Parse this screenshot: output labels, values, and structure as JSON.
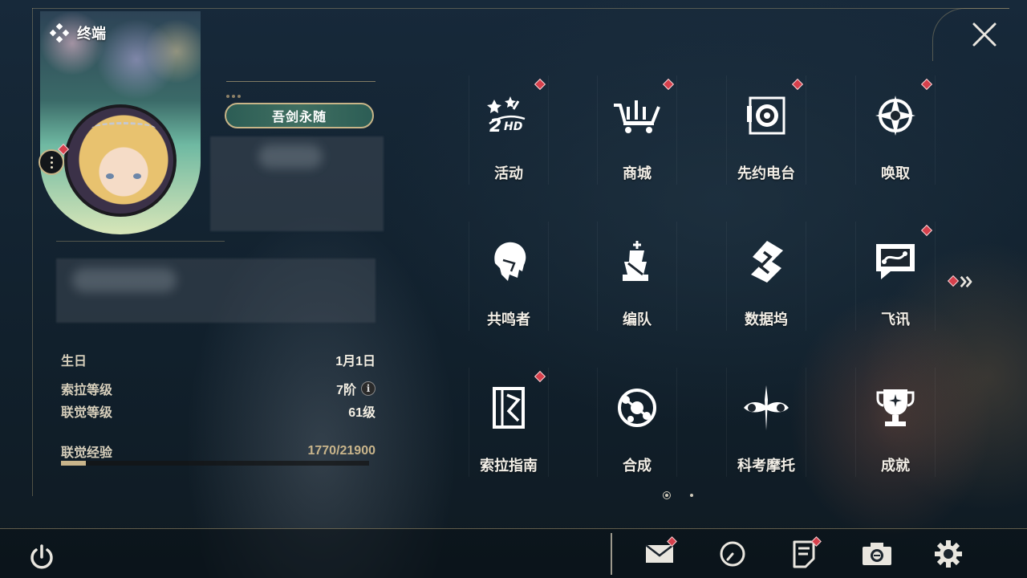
{
  "terminal": {
    "title": "终端"
  },
  "profile": {
    "title_badge": "吾剑永随"
  },
  "stats": {
    "birthday_label": "生日",
    "birthday_value": "1月1日",
    "sola_level_label": "索拉等级",
    "sola_level_value": "7阶",
    "union_level_label": "联觉等级",
    "union_level_value": "61级",
    "union_exp_label": "联觉经验",
    "union_exp_value": "1770/21900",
    "union_exp_progress": 0.081
  },
  "menu": {
    "items": [
      {
        "label": "活动",
        "icon": "event-2hd-icon",
        "badge": true
      },
      {
        "label": "商城",
        "icon": "shop-cart-icon",
        "badge": true
      },
      {
        "label": "先约电台",
        "icon": "radio-icon",
        "badge": true
      },
      {
        "label": "唤取",
        "icon": "convene-star-icon",
        "badge": true
      },
      {
        "label": "共鸣者",
        "icon": "resonator-head-icon",
        "badge": false
      },
      {
        "label": "编队",
        "icon": "team-chess-icon",
        "badge": false
      },
      {
        "label": "数据坞",
        "icon": "data-dock-icon",
        "badge": false
      },
      {
        "label": "飞讯",
        "icon": "message-bubble-icon",
        "badge": true
      },
      {
        "label": "索拉指南",
        "icon": "guidebook-icon",
        "badge": true
      },
      {
        "label": "合成",
        "icon": "synthesis-icon",
        "badge": false
      },
      {
        "label": "科考摩托",
        "icon": "motorcycle-icon",
        "badge": false
      },
      {
        "label": "成就",
        "icon": "trophy-icon",
        "badge": false
      }
    ],
    "page_current": 1,
    "page_total": 2
  },
  "icons": {
    "close": "close-x-icon",
    "power": "power-icon",
    "mail": "mail-icon",
    "clock": "clock-icon",
    "notes": "notes-icon",
    "camera": "camera-icon",
    "settings": "gear-icon",
    "next": "double-chevron-right-icon",
    "more": "more-vertical-icon"
  },
  "colors": {
    "accent_gold": "#c8b588",
    "badge_red": "#d6404c",
    "text_light": "#f2eee6"
  }
}
